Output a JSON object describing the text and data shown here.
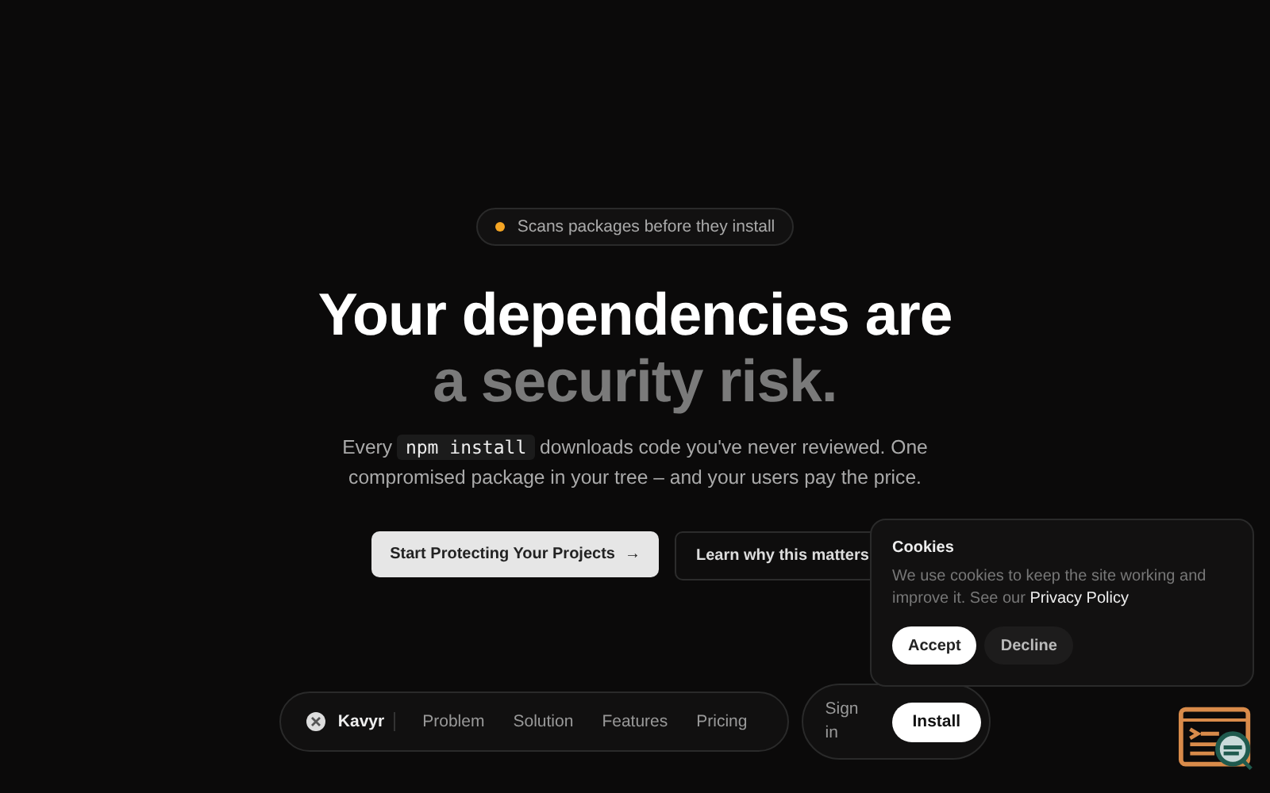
{
  "badge": {
    "text": "Scans packages before they install",
    "color": "#f5a524"
  },
  "headline": {
    "line_1": "Your dependencies are",
    "line_2": "a security risk."
  },
  "intro": {
    "before": "Every",
    "code": "npm install",
    "after": "downloads code you've never reviewed. One compromised package in your tree – and your users pay the price."
  },
  "actions": [
    {
      "label": "Start Protecting Your Projects",
      "arrow": "→",
      "kind": "primary"
    },
    {
      "label": "Learn why this matters",
      "kind": "secondary"
    }
  ],
  "nav": {
    "brand": "Kavyr",
    "links": [
      "Problem",
      "Solution",
      "Features",
      "Pricing"
    ],
    "sign_in": "Sign in",
    "install": "Install"
  },
  "cookie_banner": {
    "title": "Cookies",
    "text": "We use cookies to keep the site working and improve it. See our",
    "link": "Privacy Policy",
    "buttons": [
      {
        "label": "Accept",
        "kind": "primary"
      },
      {
        "label": "Decline",
        "kind": "secondary"
      }
    ]
  }
}
